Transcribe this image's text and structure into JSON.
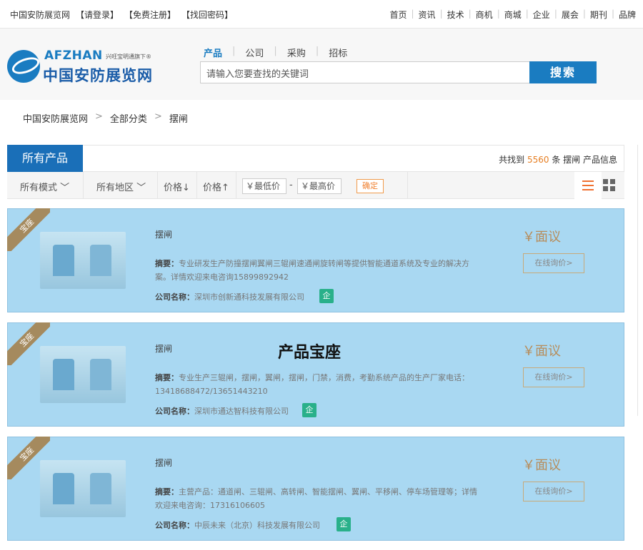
{
  "topbar": {
    "site_name": "中国安防展览网",
    "login": "【请登录】",
    "register": "【免费注册】",
    "recover": "【找回密码】",
    "nav": [
      "首页",
      "资讯",
      "技术",
      "商机",
      "商城",
      "企业",
      "展会",
      "期刊",
      "品牌"
    ]
  },
  "logo": {
    "en": "AFZHAN",
    "sub": "兴旺宝明通旗下",
    "registered": "®",
    "cn": "中国安防展览网"
  },
  "search": {
    "tabs": [
      "产品",
      "公司",
      "采购",
      "招标"
    ],
    "placeholder": "请输入您要查找的关键词",
    "button": "搜索"
  },
  "breadcrumb": [
    "中国安防展览网",
    "全部分类",
    "摆闸"
  ],
  "products_header": {
    "tab": "所有产品",
    "result_prefix": "共找到",
    "result_count": "5560",
    "result_suffix": "条 摆闸 产品信息"
  },
  "filters": {
    "mode": "所有模式",
    "region": "所有地区",
    "price_down": "价格",
    "price_up": "价格",
    "min_price": "￥最低价",
    "dash": "-",
    "max_price": "￥最高价",
    "confirm": "确定"
  },
  "cards": [
    {
      "ribbon": "宝座",
      "name": "摆闸",
      "abstract_label": "摘要：",
      "abstract": "专业研发生产防撞摆闸翼闸三辊闸速通闸旋转闸等提供智能通道系统及专业的解决方案。详情欢迎来电咨询15899892942",
      "company_label": "公司名称：",
      "company": "深圳市创新通科技发展有限公司",
      "badge": "企",
      "price": "￥面议",
      "inquiry": "在线询价>"
    },
    {
      "ribbon": "宝座",
      "name": "摆闸",
      "abstract_label": "摘要：",
      "abstract": "专业生产三辊闸，摆闸，翼闸，摆闸，门禁，消费，考勤系统产品的生产厂家电话：13418688472/13651443210",
      "company_label": "公司名称：",
      "company": "深圳市通达智科技有限公司",
      "badge": "企",
      "price": "￥面议",
      "inquiry": "在线询价>"
    },
    {
      "ribbon": "宝座",
      "name": "摆闸",
      "abstract_label": "摘要：",
      "abstract": "主营产品：通道闸、三辊闸、高转闸、智能摆闸、翼闸、平移闸、停车场管理等；详情欢迎来电咨询：17316106605",
      "company_label": "公司名称：",
      "company": "中辰未来（北京）科技发展有限公司",
      "badge": "企",
      "price": "￥面议",
      "inquiry": "在线询价>"
    }
  ],
  "overlay_label": "产品宝座",
  "colors": {
    "brand_blue": "#1a7cc1",
    "highlight": "#a9d8f2",
    "accent_orange": "#e67e22",
    "ribbon": "#a58a5e",
    "badge_green": "#29b08a"
  }
}
